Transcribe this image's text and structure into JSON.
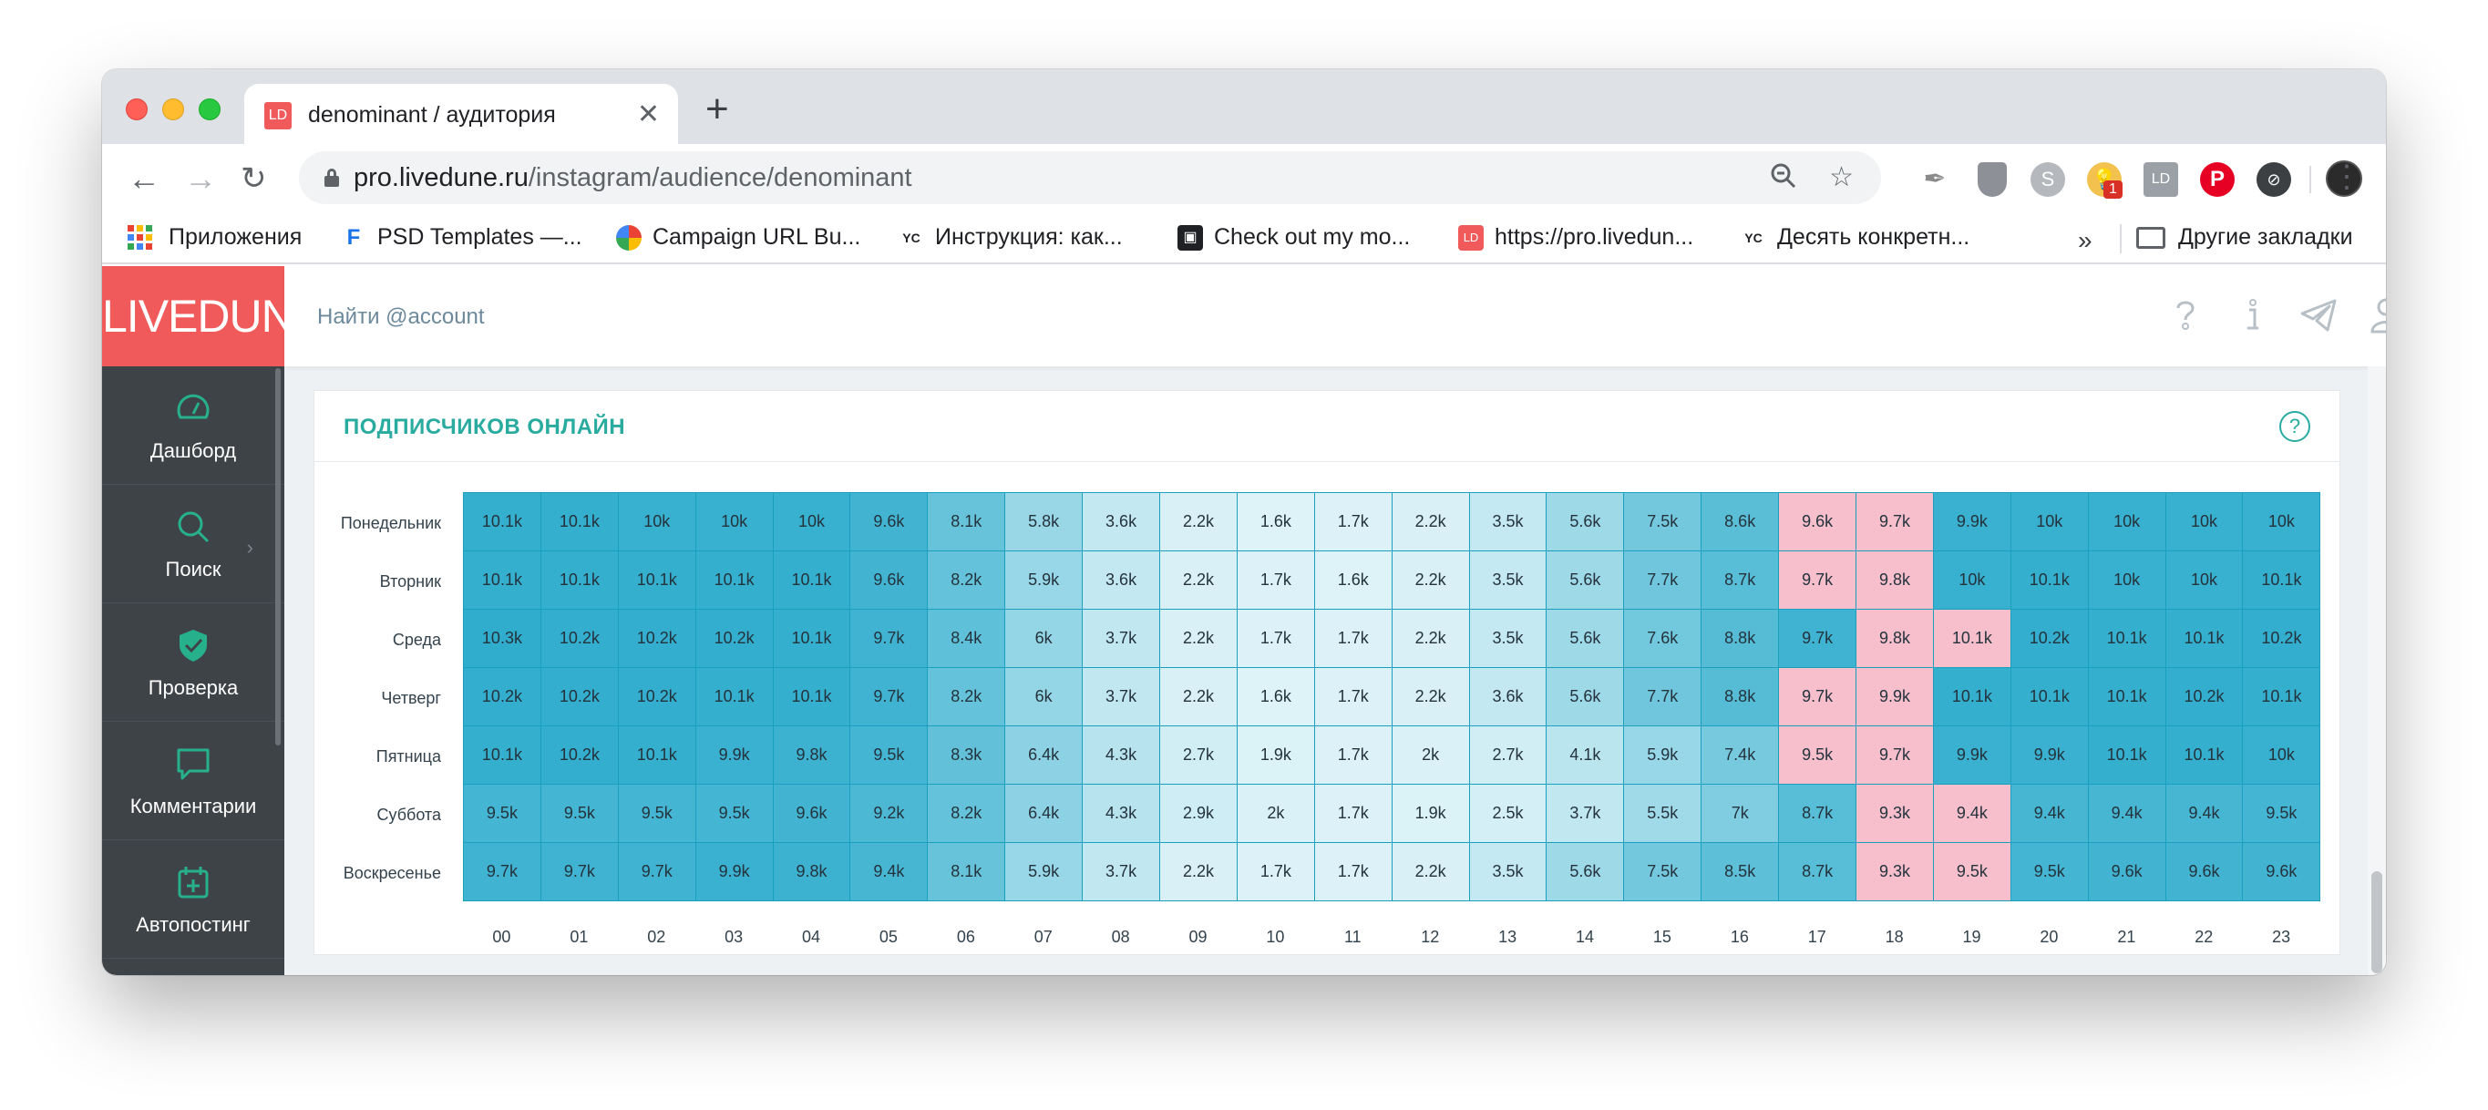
{
  "browser": {
    "tab_title": "denominant / аудитория",
    "tab_favicon": "LD",
    "url_host": "pro.livedune.ru",
    "url_path": "/instagram/audience/denominant"
  },
  "bookmarks": {
    "items": [
      {
        "label": "Приложения",
        "icon": "apps-grid-icon"
      },
      {
        "label": "PSD Templates —...",
        "icon": "F",
        "color": "#1a73e8"
      },
      {
        "label": "Campaign URL Bu...",
        "icon": "campaign-icon",
        "color": "#f4b400"
      },
      {
        "label": "Инструкция: как...",
        "icon": "YC",
        "color": "#202124"
      },
      {
        "label": "Check out my mo...",
        "icon": "bookmark-dark-icon",
        "color": "#202124"
      },
      {
        "label": "https://pro.livedun...",
        "icon": "LD",
        "color": "#f05a5a"
      },
      {
        "label": "Десять конкретн...",
        "icon": "YC",
        "color": "#202124"
      }
    ],
    "more": "»",
    "other": "Другие закладки"
  },
  "extensions": {
    "notification_badge": "1"
  },
  "app": {
    "logo": "LIVEDUNE",
    "search_placeholder": "Найти @account",
    "sidebar": [
      {
        "label": "Дашборд",
        "icon": "dashboard-icon"
      },
      {
        "label": "Поиск",
        "icon": "search-icon"
      },
      {
        "label": "Проверка",
        "icon": "shield-check-icon"
      },
      {
        "label": "Комментарии",
        "icon": "comment-icon"
      },
      {
        "label": "Автопостинг",
        "icon": "calendar-plus-icon"
      }
    ],
    "card_title": "ПОДПИСЧИКОВ ОНЛАЙН",
    "help_glyph": "?"
  },
  "colors": {
    "brand": "#f05a5a",
    "accent": "#2aab9f",
    "heat_peak": "#f7bfcc",
    "heat_high": "#30adcd",
    "heat_low": "#def3f8"
  },
  "chart_data": {
    "type": "heatmap",
    "title": "ПОДПИСЧИКОВ ОНЛАЙН",
    "x": [
      "00",
      "01",
      "02",
      "03",
      "04",
      "05",
      "06",
      "07",
      "08",
      "09",
      "10",
      "11",
      "12",
      "13",
      "14",
      "15",
      "16",
      "17",
      "18",
      "19",
      "20",
      "21",
      "22",
      "23"
    ],
    "y": [
      "Понедельник",
      "Вторник",
      "Среда",
      "Четверг",
      "Пятница",
      "Суббота",
      "Воскресенье"
    ],
    "values": [
      [
        "10.1k",
        "10.1k",
        "10k",
        "10k",
        "10k",
        "9.6k",
        "8.1k",
        "5.8k",
        "3.6k",
        "2.2k",
        "1.6k",
        "1.7k",
        "2.2k",
        "3.5k",
        "5.6k",
        "7.5k",
        "8.6k",
        "9.6k",
        "9.7k",
        "9.9k",
        "10k",
        "10k",
        "10k",
        "10k"
      ],
      [
        "10.1k",
        "10.1k",
        "10.1k",
        "10.1k",
        "10.1k",
        "9.6k",
        "8.2k",
        "5.9k",
        "3.6k",
        "2.2k",
        "1.7k",
        "1.6k",
        "2.2k",
        "3.5k",
        "5.6k",
        "7.7k",
        "8.7k",
        "9.7k",
        "9.8k",
        "10k",
        "10.1k",
        "10k",
        "10k",
        "10.1k"
      ],
      [
        "10.3k",
        "10.2k",
        "10.2k",
        "10.2k",
        "10.1k",
        "9.7k",
        "8.4k",
        "6k",
        "3.7k",
        "2.2k",
        "1.7k",
        "1.7k",
        "2.2k",
        "3.5k",
        "5.6k",
        "7.6k",
        "8.8k",
        "9.7k",
        "9.8k",
        "10.1k",
        "10.2k",
        "10.1k",
        "10.1k",
        "10.2k"
      ],
      [
        "10.2k",
        "10.2k",
        "10.2k",
        "10.1k",
        "10.1k",
        "9.7k",
        "8.2k",
        "6k",
        "3.7k",
        "2.2k",
        "1.6k",
        "1.7k",
        "2.2k",
        "3.6k",
        "5.6k",
        "7.7k",
        "8.8k",
        "9.7k",
        "9.9k",
        "10.1k",
        "10.1k",
        "10.1k",
        "10.2k",
        "10.1k"
      ],
      [
        "10.1k",
        "10.2k",
        "10.1k",
        "9.9k",
        "9.8k",
        "9.5k",
        "8.3k",
        "6.4k",
        "4.3k",
        "2.7k",
        "1.9k",
        "1.7k",
        "2k",
        "2.7k",
        "4.1k",
        "5.9k",
        "7.4k",
        "9.5k",
        "9.7k",
        "9.9k",
        "9.9k",
        "10.1k",
        "10.1k",
        "10k"
      ],
      [
        "9.5k",
        "9.5k",
        "9.5k",
        "9.5k",
        "9.6k",
        "9.2k",
        "8.2k",
        "6.4k",
        "4.3k",
        "2.9k",
        "2k",
        "1.7k",
        "1.9k",
        "2.5k",
        "3.7k",
        "5.5k",
        "7k",
        "8.7k",
        "9.3k",
        "9.4k",
        "9.4k",
        "9.4k",
        "9.4k",
        "9.5k"
      ],
      [
        "9.7k",
        "9.7k",
        "9.7k",
        "9.9k",
        "9.8k",
        "9.4k",
        "8.1k",
        "5.9k",
        "3.7k",
        "2.2k",
        "1.7k",
        "1.7k",
        "2.2k",
        "3.5k",
        "5.6k",
        "7.5k",
        "8.5k",
        "8.7k",
        "9.3k",
        "9.5k",
        "9.5k",
        "9.6k",
        "9.6k",
        "9.6k"
      ]
    ],
    "highlighted": [
      [
        17,
        18
      ],
      [
        17,
        18
      ],
      [
        18,
        19
      ],
      [
        17,
        18
      ],
      [
        17,
        18
      ],
      [
        18,
        19
      ],
      [
        18,
        19
      ]
    ]
  }
}
